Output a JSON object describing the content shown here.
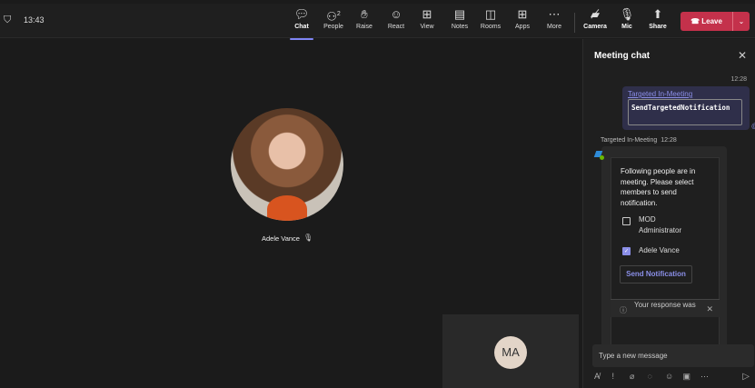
{
  "header": {
    "time": "13:43"
  },
  "toolbar": {
    "items": [
      {
        "label": "Chat",
        "icon": "chat-icon"
      },
      {
        "label": "People",
        "icon": "people-icon",
        "badge": "2"
      },
      {
        "label": "Raise",
        "icon": "hand-icon"
      },
      {
        "label": "React",
        "icon": "smile-icon"
      },
      {
        "label": "View",
        "icon": "view-icon"
      },
      {
        "label": "Notes",
        "icon": "notes-icon"
      },
      {
        "label": "Rooms",
        "icon": "rooms-icon"
      },
      {
        "label": "Apps",
        "icon": "apps-icon"
      },
      {
        "label": "More",
        "icon": "more-icon"
      },
      {
        "label": "Camera",
        "icon": "camera-off-icon"
      },
      {
        "label": "Mic",
        "icon": "mic-off-icon"
      },
      {
        "label": "Share",
        "icon": "share-icon"
      }
    ],
    "leave": "Leave"
  },
  "stage": {
    "participant": "Adele Vance",
    "tile_initials": "MA"
  },
  "chat": {
    "title": "Meeting chat",
    "messages": [
      {
        "time": "12:28",
        "link": "Targeted In-Meeting",
        "code": "SendTargetedNotification"
      },
      {
        "sender": "Targeted In-Meeting",
        "time": "12:28",
        "card": {
          "text": "Following people are in meeting. Please select members to send notification.",
          "options": [
            {
              "label": "MOD Administrator",
              "checked": false
            },
            {
              "label": "Adele Vance",
              "checked": true
            }
          ],
          "button": "Send Notification",
          "response": "Your response was"
        }
      }
    ],
    "compose_placeholder": "Type a new message"
  },
  "colors": {
    "accent": "#7f85f5",
    "leave": "#c4314b"
  }
}
